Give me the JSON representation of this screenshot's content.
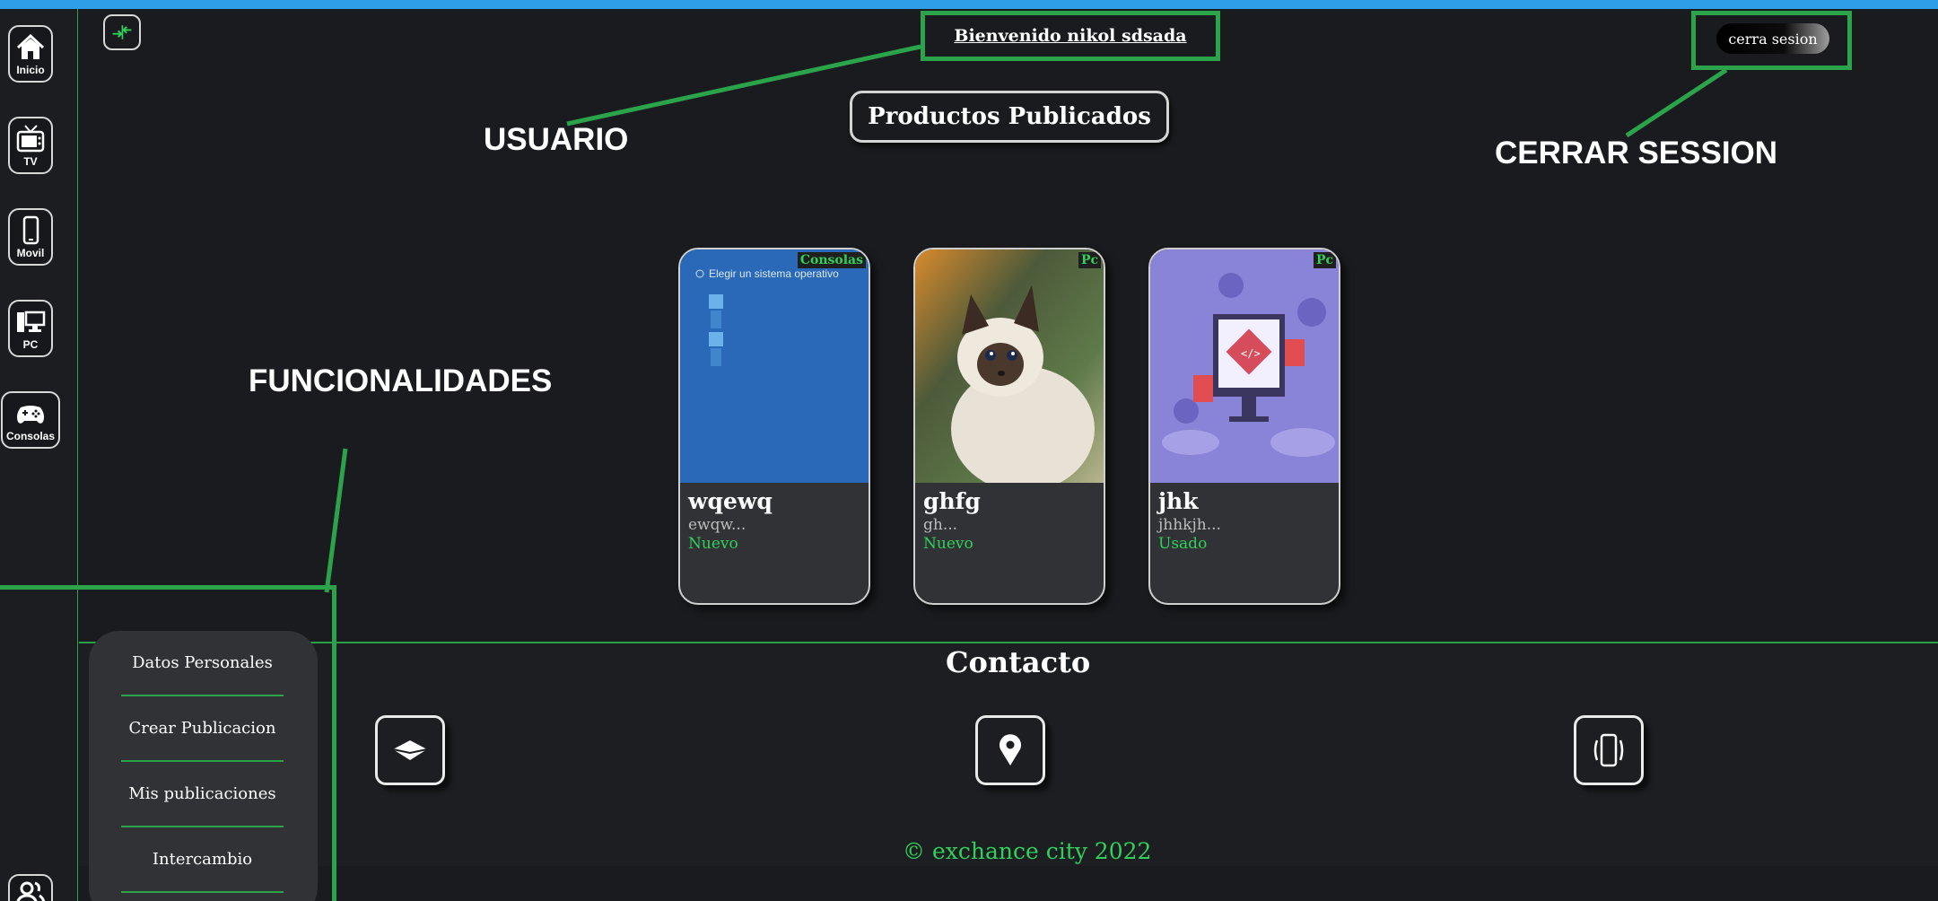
{
  "sidebar": {
    "items": [
      {
        "label": "Inicio",
        "icon": "home-icon"
      },
      {
        "label": "TV",
        "icon": "tv-icon"
      },
      {
        "label": "Movil",
        "icon": "phone-icon"
      },
      {
        "label": "PC",
        "icon": "pc-icon"
      },
      {
        "label": "Consolas",
        "icon": "gamepad-icon"
      }
    ],
    "bottom_icon": "users-icon"
  },
  "header": {
    "collapse_icon": "collapse-icon",
    "welcome": "Bienvenido nikol sdsada",
    "logout_label": "cerra sesion"
  },
  "annotations": {
    "usuario": "USUARIO",
    "cerrar": "CERRAR SESSION",
    "funcionalidades": "FUNCIONALIDADES"
  },
  "main": {
    "title": "Productos Publicados",
    "products": [
      {
        "name": "wqewq",
        "desc": "ewqw...",
        "condition": "Nuevo",
        "category": "Consolas",
        "image_text": "Elegir un sistema operativo"
      },
      {
        "name": "ghfg",
        "desc": "gh...",
        "condition": "Nuevo",
        "category": "Pc"
      },
      {
        "name": "jhk",
        "desc": "jhhkjh...",
        "condition": "Usado",
        "category": "Pc"
      }
    ]
  },
  "footer": {
    "title": "Contacto",
    "icons": [
      "email-icon",
      "location-icon",
      "phone-vibrate-icon"
    ],
    "copyright": "© exchance city 2022"
  },
  "menu": {
    "items": [
      "Datos Personales",
      "Crear Publicacion",
      "Mis publicaciones",
      "Intercambio"
    ]
  },
  "colors": {
    "accent": "#2aa34a",
    "accent_text": "#2fd15a",
    "background": "#191b1e",
    "card": "#303236",
    "topbar": "#2f9ee8"
  }
}
